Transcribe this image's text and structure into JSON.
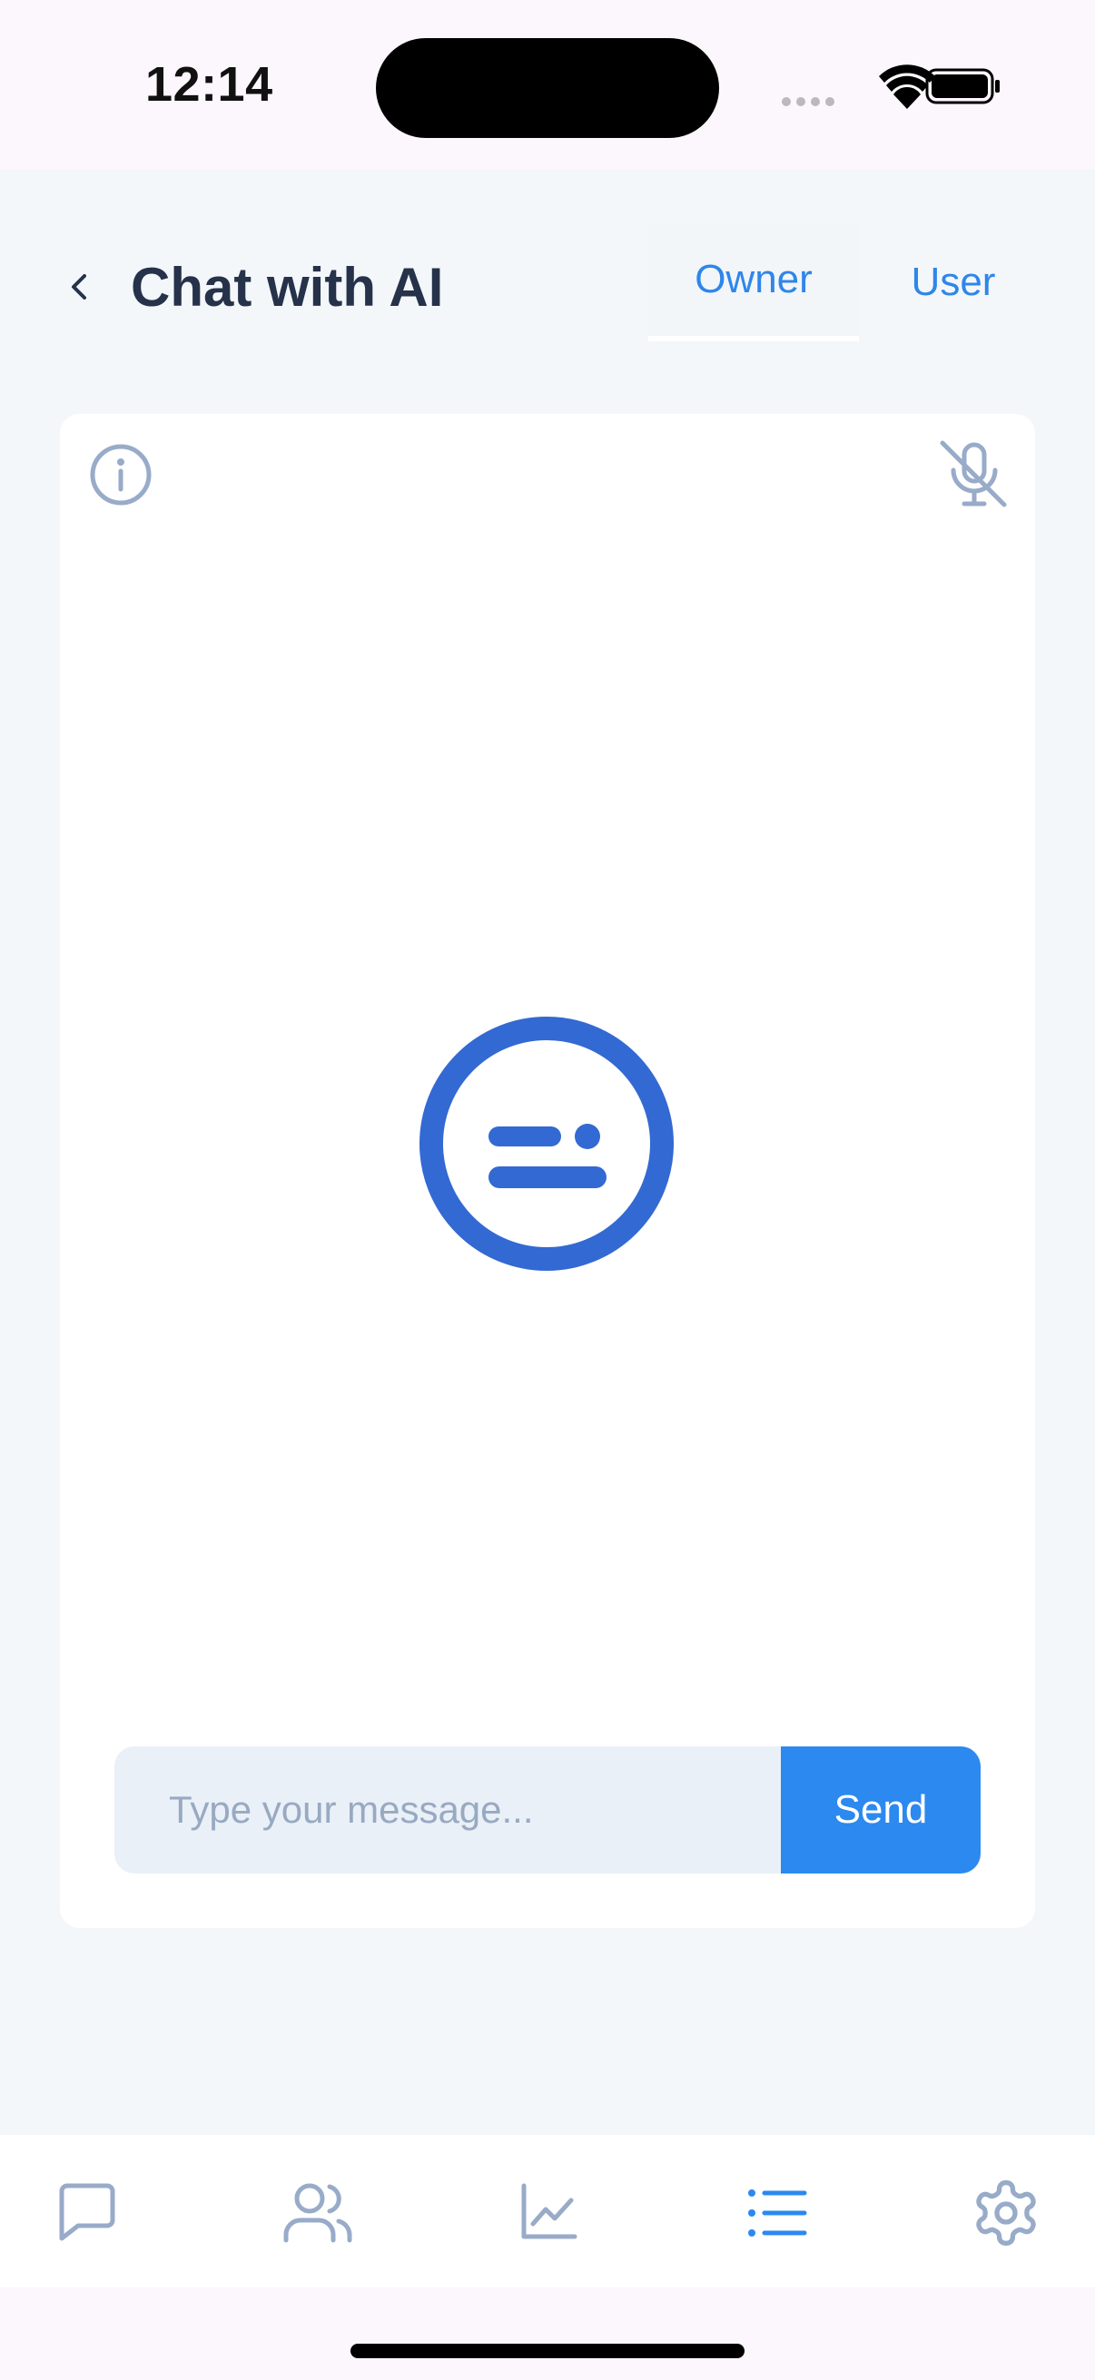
{
  "status_bar": {
    "time": "12:14",
    "icons": [
      "cellular-icon",
      "wifi-icon",
      "battery-icon"
    ]
  },
  "header": {
    "back_icon": "chevron-left-icon",
    "title": "Chat with AI",
    "tabs": [
      {
        "label": "Owner",
        "selected": true
      },
      {
        "label": "User",
        "selected": false
      }
    ]
  },
  "chat": {
    "info_icon": "info-icon",
    "mic_icon": "mic-off-icon",
    "bot_icon": "bot-face-icon",
    "input": {
      "value": "",
      "placeholder": "Type your message..."
    },
    "send_label": "Send"
  },
  "bottom_nav": {
    "items": [
      {
        "icon": "chat-bubble-icon",
        "active": false
      },
      {
        "icon": "users-icon",
        "active": false
      },
      {
        "icon": "chart-line-icon",
        "active": false
      },
      {
        "icon": "list-icon",
        "active": true
      },
      {
        "icon": "gear-icon",
        "active": false
      }
    ]
  },
  "colors": {
    "accent": "#2b89f0",
    "bot": "#3369d2",
    "muted_icon": "#98abc8",
    "title": "#25324a"
  }
}
